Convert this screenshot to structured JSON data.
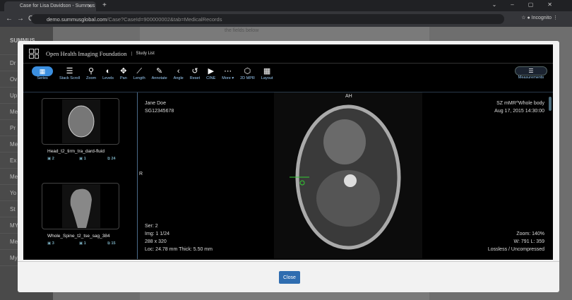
{
  "browser": {
    "tab_title": "Case for Lisa Davidson - Summus",
    "url_host": "demo.summusglobal.com",
    "url_path": "/Case?CaseId=900000002&tab=MedicalRecords",
    "profile": "Incognito"
  },
  "background": {
    "sidebar": [
      "Dr",
      "Ov Ma",
      "Up",
      "Me",
      "Pr",
      "Me",
      "Ex",
      "Me",
      "Yo",
      "St",
      "MY",
      "Me",
      "My"
    ],
    "logo_text": "SUMMUS",
    "note": "the fields below"
  },
  "viewer": {
    "brand": "Open Health Imaging Foundation",
    "study_list": "Study List",
    "tools": [
      {
        "label": "Series",
        "icon": "grid-icon",
        "g": "▦"
      },
      {
        "label": "Stack Scroll",
        "icon": "stack-scroll-icon",
        "g": "☰"
      },
      {
        "label": "Zoom",
        "icon": "zoom-icon",
        "g": "⚲"
      },
      {
        "label": "Levels",
        "icon": "levels-icon",
        "g": "◐"
      },
      {
        "label": "Pan",
        "icon": "pan-icon",
        "g": "✥"
      },
      {
        "label": "Length",
        "icon": "length-icon",
        "g": "⟋"
      },
      {
        "label": "Annotate",
        "icon": "annotate-icon",
        "g": "✎"
      },
      {
        "label": "Angle",
        "icon": "angle-icon",
        "g": "‹"
      },
      {
        "label": "Reset",
        "icon": "reset-icon",
        "g": "↺"
      },
      {
        "label": "CINE",
        "icon": "cine-icon",
        "g": "▶"
      },
      {
        "label": "More ▾",
        "icon": "more-icon",
        "g": "⋯"
      },
      {
        "label": "2D MPR",
        "icon": "cube-icon",
        "g": "⬡"
      },
      {
        "label": "Layout",
        "icon": "layout-icon",
        "g": "▦"
      }
    ],
    "measurements": "Measurements",
    "series": [
      {
        "name": "Head_t2_tirm_tra_dard-fluid",
        "series_no": "2",
        "instances_no": "1",
        "images": "24"
      },
      {
        "name": "Whole_Spine_t2_tse_sag_384",
        "series_no": "3",
        "instances_no": "1",
        "images": "15"
      }
    ],
    "overlay": {
      "patient_name": "Jane Doe",
      "patient_id": "SG12345678",
      "study": "SZ mMR^Whole body",
      "date": "Aug 17, 2015 14:30:00",
      "orientation_top": "AH",
      "orientation_left": "R",
      "ser": "Ser: 2",
      "img": "Img: 1 1/24",
      "dims": "288 x 320",
      "loc": "Loc: 24.78 mm Thick: 5.50 mm",
      "zoom": "Zoom: 140%",
      "wl": "W: 791 L: 359",
      "compression": "Lossless / Uncompressed"
    },
    "close": "Close"
  }
}
